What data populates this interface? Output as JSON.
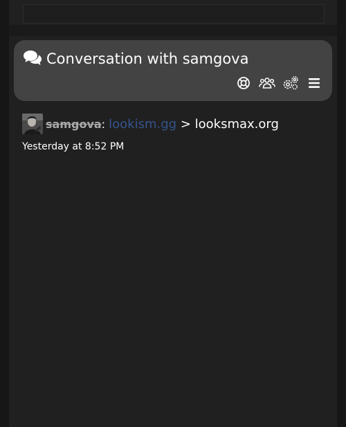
{
  "search": {
    "placeholder": ""
  },
  "header": {
    "title": "Conversation with samgova",
    "icons": [
      "conversations-icon",
      "help-icon",
      "participants-icon",
      "settings-icon",
      "menu-icon"
    ]
  },
  "message": {
    "username": "samgova",
    "separator": ":",
    "link_text": "lookism.gg",
    "arrow_text": " > looksmax.org",
    "timestamp": "Yesterday at 8:52 PM"
  },
  "colors": {
    "background": "#202020",
    "card": "#434343",
    "link": "#35548c",
    "username": "#a8a8a8"
  }
}
